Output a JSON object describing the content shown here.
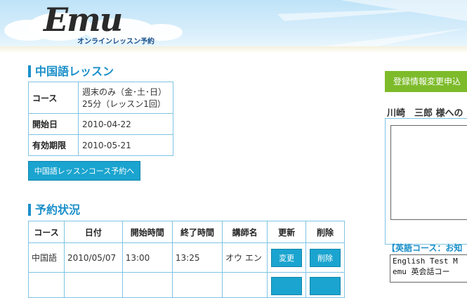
{
  "header": {
    "logo": "Emu",
    "logo_sub": "オンラインレッスン予約"
  },
  "course": {
    "title": "中国語レッスン",
    "rows": [
      {
        "label": "コース",
        "value_line1": "週末のみ（金･土･日）",
        "value_line2": "25分（レッスン1回）"
      },
      {
        "label": "開始日",
        "value": "2010-04-22"
      },
      {
        "label": "有効期限",
        "value": "2010-05-21"
      }
    ],
    "button": "中国語レッスンコース予約へ"
  },
  "reservations": {
    "title": "予約状況",
    "headers": [
      "コース",
      "日付",
      "開始時間",
      "終了時間",
      "講師名",
      "更新",
      "削除"
    ],
    "rows": [
      {
        "course": "中国語",
        "date": "2010/05/07",
        "start": "13:00",
        "end": "13:25",
        "teacher": "オウ エン",
        "update": "変更",
        "delete": "削除"
      }
    ]
  },
  "sidebar": {
    "update_button": "登録情報変更申込",
    "user_line": "川崎　三郎 様への",
    "news_title": "【英語コース：お知",
    "news_lines": [
      "English Test M",
      "emu 英会話コー"
    ]
  },
  "colors": {
    "accent": "#1a8fc9",
    "button": "#1aa4cf",
    "green": "#7dbb2a",
    "border": "#7fc4e4"
  }
}
